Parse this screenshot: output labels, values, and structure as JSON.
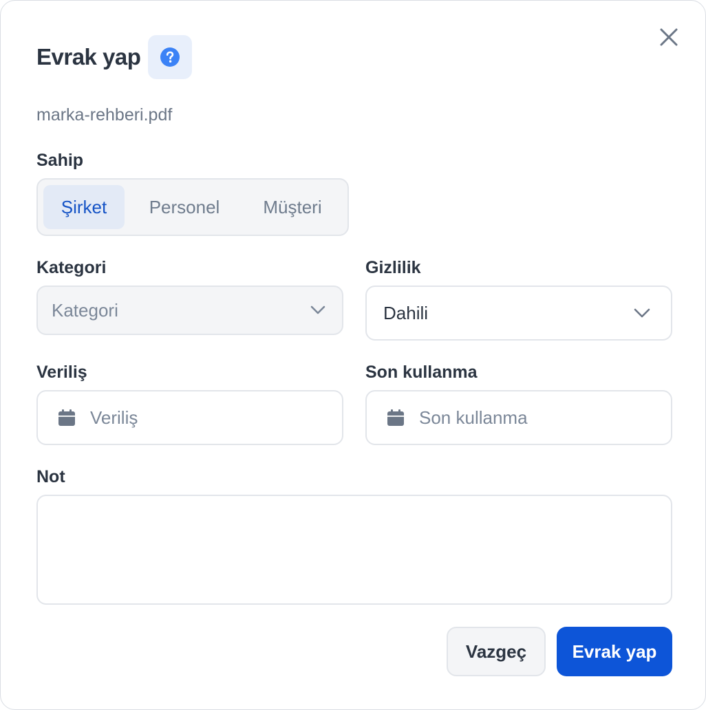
{
  "dialog": {
    "title": "Evrak yap",
    "filename": "marka-rehberi.pdf"
  },
  "owner": {
    "label": "Sahip",
    "options": [
      "Şirket",
      "Personel",
      "Müşteri"
    ],
    "selected": "Şirket"
  },
  "category": {
    "label": "Kategori",
    "placeholder": "Kategori"
  },
  "privacy": {
    "label": "Gizlilik",
    "value": "Dahili"
  },
  "issue_date": {
    "label": "Veriliş",
    "placeholder": "Veriliş"
  },
  "expiry_date": {
    "label": "Son kullanma",
    "placeholder": "Son kullanma"
  },
  "note": {
    "label": "Not",
    "value": ""
  },
  "actions": {
    "cancel_label": "Vazgeç",
    "submit_label": "Evrak yap"
  },
  "icons": {
    "help": "question-circle-icon",
    "close": "close-icon",
    "chevron": "chevron-down-icon",
    "calendar": "calendar-icon"
  },
  "colors": {
    "primary": "#0d55d8",
    "help_icon": "#3b82f6",
    "active_segment_text": "#1553c6",
    "text": "#2b3441",
    "muted": "#6b7686"
  }
}
